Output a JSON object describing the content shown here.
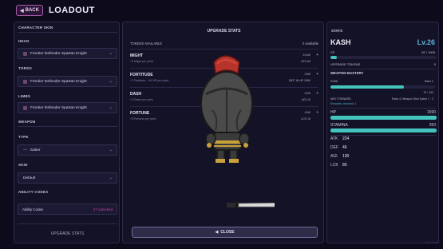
{
  "header": {
    "back_label": "BACK",
    "title": "LOADOUT"
  },
  "left": {
    "character_skin": "CHARACTER SKIN",
    "head_label": "HEAD",
    "head_value": "Frontier Defender Spartan Knight",
    "torso_label": "TORSO",
    "torso_value": "Frontier Defender Spartan Knight",
    "limbs_label": "LIMBS",
    "limbs_value": "Frontier Defender Spartan Knight",
    "weapon_label": "WEAPON",
    "type_label": "TYPE",
    "type_value": "Saber",
    "skin_label": "SKIN",
    "skin_value": "Default",
    "codex_label": "ABILITY CODEX",
    "codex_name": "Ability Codex",
    "codex_unlocked": "27 unlocked",
    "upgrade_stats": "UPGRADE STATS"
  },
  "center": {
    "title": "UPGRADE STATS",
    "tokens_label": "TOKENS AVAILABLE",
    "tokens_value": "0 available",
    "stats": [
      {
        "name": "MIGHT",
        "desc": "+3 Might per point",
        "level": "10/40",
        "current": "ATK 64"
      },
      {
        "name": "FORTITUDE",
        "desc": "+7 Fortitude, +16 HP per point",
        "level": "0/40",
        "current": "DEF 16 HP 1590"
      },
      {
        "name": "DASH",
        "desc": "+2 Dash per point",
        "level": "0/40",
        "current": "AGI 10"
      },
      {
        "name": "FORTUNE",
        "desc": "+5 Fortune per point",
        "level": "0/40",
        "current": "LCK 15"
      }
    ],
    "close_label": "CLOSE"
  },
  "right": {
    "title": "STATS",
    "name": "KASH",
    "level": "Lv.26",
    "xp_label": "XP",
    "xp_value": "62 / 1000",
    "xp_fraction": 0.062,
    "upgrade_tokens_label": "UPGRADE TOKENS",
    "upgrade_tokens_value": "0",
    "mastery_label": "WEAPON MASTERY",
    "rank_label": "RANK",
    "rank_value": "Rank 2",
    "rank_fraction": 0.7,
    "rank_progress": "70 / 100",
    "next_reward_label": "NEXT REWARD",
    "next_reward_value": "Rank 4: Weapon Skin Saber 1 · 2",
    "rewards_unlocked": "Rewards unlocked: 1",
    "hp_label": "HP",
    "hp_value": "1590",
    "stamina_label": "STAMINA",
    "stamina_value": "250",
    "atk_label": "ATK",
    "atk_value": "224",
    "def_label": "DEF",
    "def_value": "46",
    "agi_label": "AGI",
    "agi_value": "130",
    "lck_label": "LCK",
    "lck_value": "80",
    "version": "v0.1.0 alpha"
  },
  "colors": {
    "accent": "#45c4bd",
    "level": "#5fb0dc",
    "back_border": "#a85aa8",
    "codex_unlocked": "#c2459a"
  }
}
